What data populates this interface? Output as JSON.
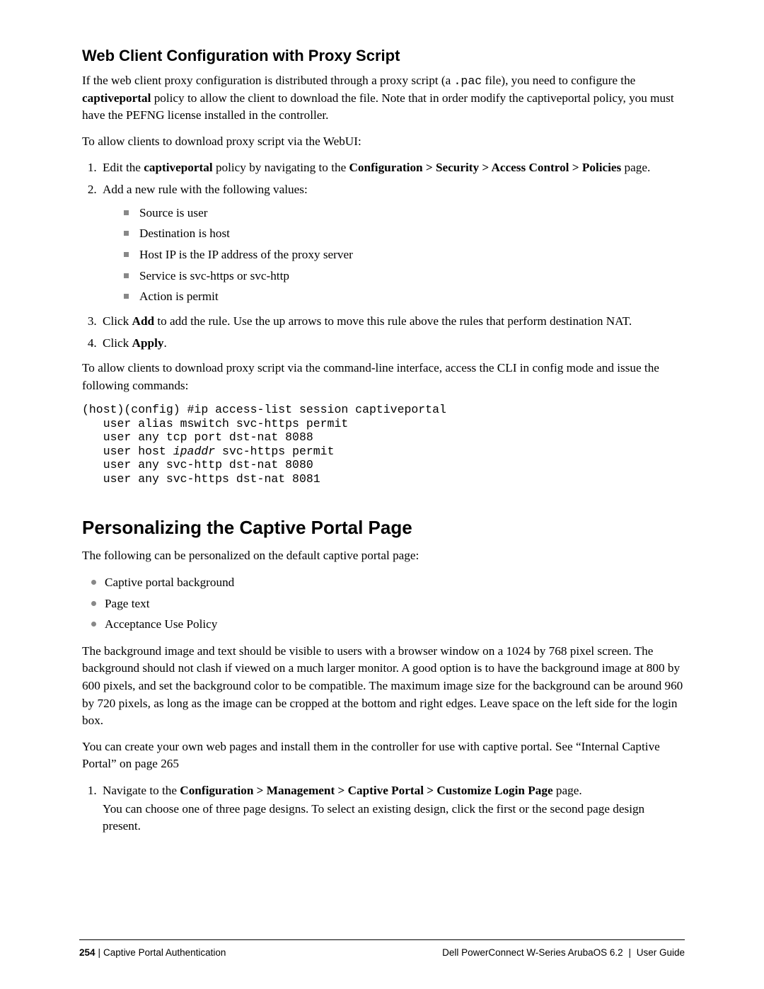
{
  "section1": {
    "heading": "Web Client Configuration with Proxy Script",
    "p1_a": "If the web client proxy configuration is distributed through a proxy script (a ",
    "p1_pac": ".pac",
    "p1_b": " file), you need to configure the ",
    "p1_captive": "captiveportal",
    "p1_c": " policy to allow the client to download the file. Note that in order modify the captiveportal policy, you must have the PEFNG license installed in the controller.",
    "p2": "To allow clients to download proxy script via the WebUI:",
    "li1_a": "Edit the ",
    "li1_b": "captiveportal",
    "li1_c": " policy by navigating to the ",
    "li1_d": "Configuration > Security > Access Control > Policies",
    "li1_e": " page.",
    "li2": "Add a new rule with the following values:",
    "sub": {
      "a": "Source is user",
      "b": "Destination is host",
      "c": "Host IP is the IP address of the proxy server",
      "d": "Service is svc-https or svc-http",
      "e": "Action is permit"
    },
    "li3_a": "Click ",
    "li3_b": "Add",
    "li3_c": " to add the rule. Use the up arrows to move this rule above the rules that perform destination NAT.",
    "li4_a": "Click ",
    "li4_b": "Apply",
    "li4_c": ".",
    "p3": "To allow clients to download proxy script via the command-line interface, access the CLI in config mode and issue the following commands:",
    "code_l1": "(host)(config) #ip access-list session captiveportal",
    "code_l2": "   user alias mswitch svc-https permit",
    "code_l3": "   user any tcp port dst-nat 8088",
    "code_l4a": "   user host ",
    "code_l4b": "ipaddr",
    "code_l4c": " svc-https permit",
    "code_l5": "   user any svc-http dst-nat 8080",
    "code_l6": "   user any svc-https dst-nat 8081"
  },
  "section2": {
    "heading": "Personalizing the Captive Portal Page",
    "p1": "The following can be personalized on the default captive portal page:",
    "bullets": {
      "a": "Captive portal background",
      "b": "Page text",
      "c": "Acceptance Use Policy"
    },
    "p2": "The background image and text should be visible to users with a browser window on a 1024 by 768 pixel screen. The background should not clash if viewed on a much larger monitor. A good option is to have the background image at 800 by 600 pixels, and set the background color to be compatible. The maximum image size for the background can be around 960 by 720 pixels, as long as the image can be cropped at the bottom and right edges. Leave space on the left side for the login box.",
    "p3": "You can create your own web pages and install them in the controller for use with captive portal. See “Internal Captive Portal” on page 265",
    "li1_a": "Navigate to the ",
    "li1_b": "Configuration > Management > Captive Portal > Customize Login Page",
    "li1_c": " page.",
    "li1_sub": "You can choose one of three page designs. To select an existing design, click the first or the second page design present."
  },
  "footer": {
    "page_no": "254",
    "chapter": "Captive Portal Authentication",
    "right": "Dell PowerConnect W-Series ArubaOS 6.2",
    "right2": "User Guide"
  }
}
